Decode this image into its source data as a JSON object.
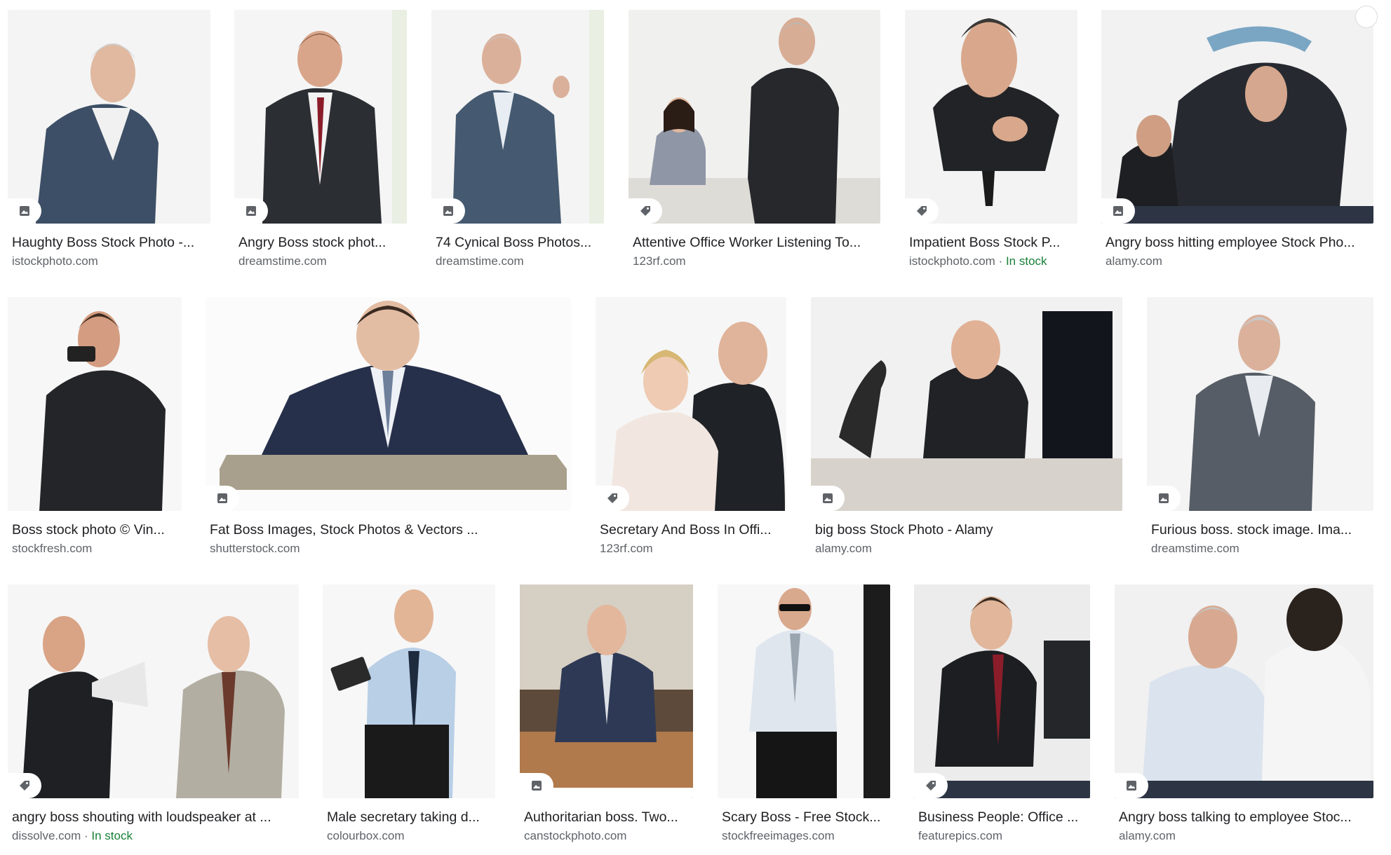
{
  "rows": [
    {
      "items": [
        {
          "title": "Haughty Boss Stock Photo -...",
          "source": "istockphoto.com",
          "badge": "image-icon",
          "stock": ""
        },
        {
          "title": "Angry Boss stock phot...",
          "source": "dreamstime.com",
          "badge": "image-icon",
          "stock": ""
        },
        {
          "title": "74 Cynical Boss Photos...",
          "source": "dreamstime.com",
          "badge": "image-icon",
          "stock": ""
        },
        {
          "title": "Attentive Office Worker Listening To...",
          "source": "123rf.com",
          "badge": "tag-icon",
          "stock": ""
        },
        {
          "title": "Impatient Boss Stock P...",
          "source": "istockphoto.com",
          "badge": "tag-icon",
          "stock": "In stock"
        },
        {
          "title": "Angry boss hitting employee Stock Pho...",
          "source": "alamy.com",
          "badge": "image-icon",
          "stock": ""
        }
      ]
    },
    {
      "items": [
        {
          "title": "Boss stock photo © Vin...",
          "source": "stockfresh.com",
          "badge": "",
          "stock": ""
        },
        {
          "title": "Fat Boss Images, Stock Photos & Vectors ...",
          "source": "shutterstock.com",
          "badge": "image-icon",
          "stock": ""
        },
        {
          "title": "Secretary And Boss In Offi...",
          "source": "123rf.com",
          "badge": "tag-icon",
          "stock": ""
        },
        {
          "title": "big boss Stock Photo - Alamy",
          "source": "alamy.com",
          "badge": "image-icon",
          "stock": ""
        },
        {
          "title": "Furious boss. stock image. Ima...",
          "source": "dreamstime.com",
          "badge": "image-icon",
          "stock": ""
        }
      ]
    },
    {
      "items": [
        {
          "title": "angry boss shouting with loudspeaker at ...",
          "source": "dissolve.com",
          "badge": "tag-icon",
          "stock": "In stock"
        },
        {
          "title": "Male secretary taking d...",
          "source": "colourbox.com",
          "badge": "",
          "stock": ""
        },
        {
          "title": "Authoritarian boss. Two...",
          "source": "canstockphoto.com",
          "badge": "image-icon",
          "stock": ""
        },
        {
          "title": "Scary Boss - Free Stock...",
          "source": "stockfreeimages.com",
          "badge": "",
          "stock": ""
        },
        {
          "title": "Business People: Office ...",
          "source": "featurepics.com",
          "badge": "tag-icon",
          "stock": ""
        },
        {
          "title": "Angry boss talking to employee Stoc...",
          "source": "alamy.com",
          "badge": "image-icon",
          "stock": ""
        }
      ]
    }
  ],
  "stock_separator": " · ",
  "colors": {
    "title": "#202124",
    "source": "#5f6368",
    "in_stock": "#188038"
  }
}
